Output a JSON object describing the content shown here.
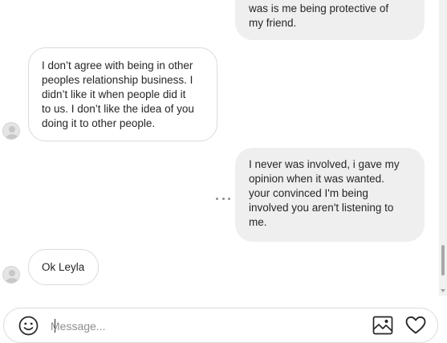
{
  "messages": [
    {
      "direction": "outgoing",
      "text": "was is me being protective of\nmy friend."
    },
    {
      "direction": "incoming",
      "text": "I don’t agree with being in other\npeoples relationship business. I\ndidn’t like it when people did it\nto us. I don’t like the idea of you\ndoing it to other people."
    },
    {
      "direction": "outgoing",
      "text": "I never was involved, i gave my\nopinion when it was wanted.\nyour convinced I'm being\ninvolved you aren't listening to\nme."
    },
    {
      "direction": "incoming",
      "text": "Ok Leyla"
    }
  ],
  "composer": {
    "placeholder": "Message...",
    "emoji_icon": "smiley-icon",
    "image_icon": "image-icon",
    "like_icon": "heart-icon"
  },
  "colors": {
    "outgoing_bubble": "#efefef",
    "incoming_border": "#dbdbdb",
    "text": "#262626",
    "placeholder": "#8e8e8e"
  }
}
